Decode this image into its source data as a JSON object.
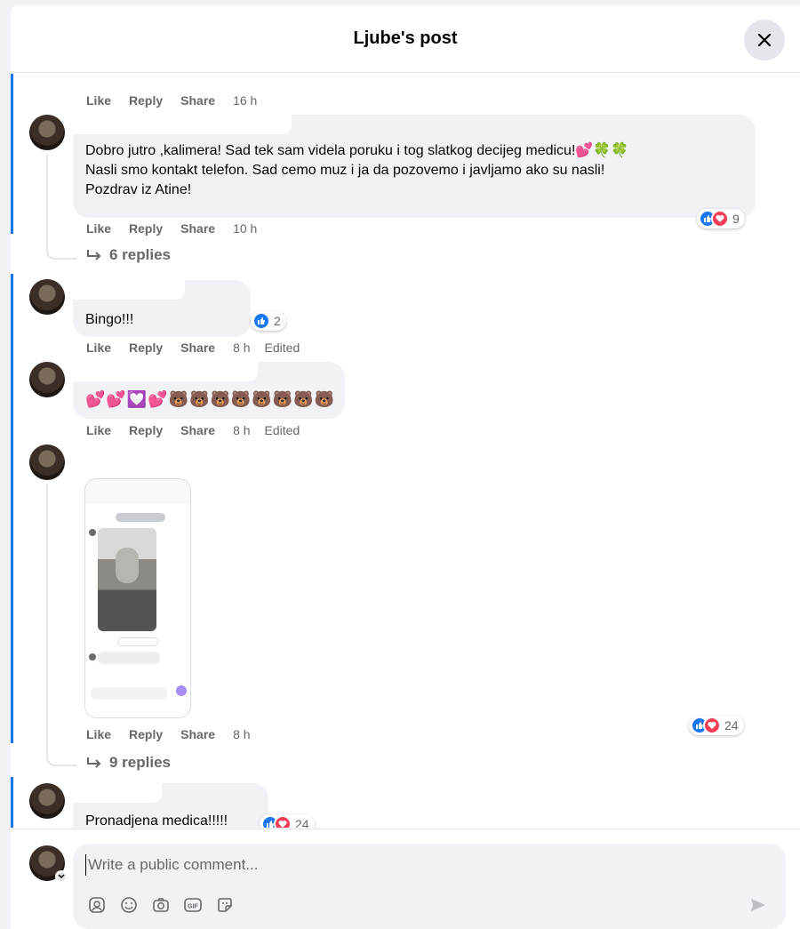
{
  "header": {
    "title": "Ljube's post"
  },
  "comments": [
    {
      "actions": {
        "like": "Like",
        "reply": "Reply",
        "share": "Share",
        "time": "16 h"
      }
    },
    {
      "text_1": "Dobro jutro ,kalimera! Sad tek sam videla poruku i tog slatkog decijeg medicu!💕🍀🍀",
      "text_2": "Nasli smo kontakt telefon. Sad cemo muz i ja da pozovemo i javljamo ako su nasli!",
      "text_3": "Pozdrav iz Atine!",
      "reactions": "9",
      "actions": {
        "like": "Like",
        "reply": "Reply",
        "share": "Share",
        "time": "10 h"
      },
      "replies": "6 replies"
    },
    {
      "text_1": "Bingo!!!",
      "reactions": "2",
      "actions": {
        "like": "Like",
        "reply": "Reply",
        "share": "Share",
        "time": "8 h",
        "edited": "Edited"
      }
    },
    {
      "text_1": "💕💕💟💕🐻🐻🐻🐻🐻🐻🐻🐻",
      "actions": {
        "like": "Like",
        "reply": "Reply",
        "share": "Share",
        "time": "8 h",
        "edited": "Edited"
      }
    },
    {
      "reactions": "24",
      "actions": {
        "like": "Like",
        "reply": "Reply",
        "share": "Share",
        "time": "8 h"
      },
      "replies": "9 replies"
    },
    {
      "text_1": "Pronadjena medica!!!!!",
      "reactions": "24"
    }
  ],
  "composer": {
    "placeholder": "Write a public comment..."
  },
  "colors": {
    "accent": "#1877f2",
    "love": "#f33e58",
    "bubble": "#f0f2f5"
  },
  "icons": [
    "close-icon",
    "reply-arrow-icon",
    "like-reaction-icon",
    "love-reaction-icon",
    "avatar-sticker-icon",
    "emoji-icon",
    "camera-icon",
    "gif-icon",
    "sticker-icon",
    "send-icon"
  ]
}
